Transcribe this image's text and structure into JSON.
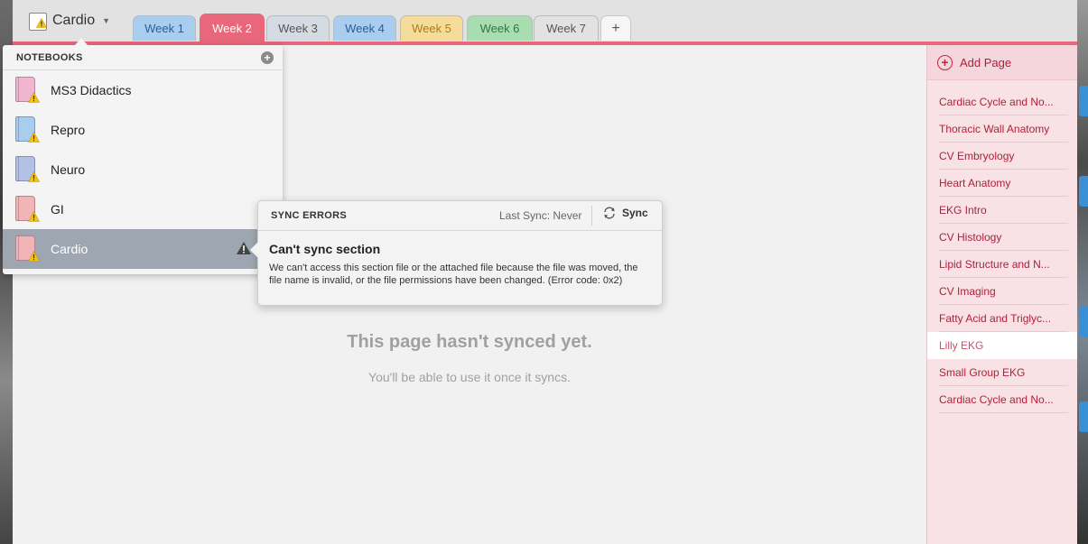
{
  "notebook_switcher": {
    "title": "Cardio"
  },
  "tabs": [
    {
      "label": "Week 1",
      "color": "#a9cdee",
      "text_color": "#2a5f98"
    },
    {
      "label": "Week 2",
      "color": "#e8677a",
      "text_color": "#ffffff"
    },
    {
      "label": "Week 3",
      "color": "#d5dbe2",
      "text_color": "#555555"
    },
    {
      "label": "Week 4",
      "color": "#a9cdee",
      "text_color": "#2a5f98"
    },
    {
      "label": "Week 5",
      "color": "#f6dc9a",
      "text_color": "#b37a12"
    },
    {
      "label": "Week 6",
      "color": "#a9dcb0",
      "text_color": "#2b7a3b"
    },
    {
      "label": "Week 7",
      "color": "#e2e2e2",
      "text_color": "#555555"
    }
  ],
  "add_tab_label": "+",
  "notebooks_panel": {
    "header": "NOTEBOOKS",
    "add_icon": "plus-circle-icon",
    "items": [
      {
        "label": "MS3 Didactics",
        "color": "#f0b6cf",
        "active": false
      },
      {
        "label": "Repro",
        "color": "#a9cdee",
        "active": false
      },
      {
        "label": "Neuro",
        "color": "#b3c1e6",
        "active": false
      },
      {
        "label": "GI",
        "color": "#f3b4b8",
        "active": false
      },
      {
        "label": "Cardio",
        "color": "#f3b4b8",
        "active": true
      }
    ]
  },
  "main": {
    "title": "This page hasn't synced yet.",
    "subtitle": "You'll be able to use it once it syncs."
  },
  "pages": {
    "add_label": "Add Page",
    "items": [
      {
        "label": "Cardiac Cycle and No...",
        "selected": false
      },
      {
        "label": "Thoracic Wall Anatomy",
        "selected": false
      },
      {
        "label": "CV Embryology",
        "selected": false
      },
      {
        "label": "Heart Anatomy",
        "selected": false
      },
      {
        "label": "EKG Intro",
        "selected": false
      },
      {
        "label": "CV Histology",
        "selected": false
      },
      {
        "label": "Lipid Structure and N...",
        "selected": false
      },
      {
        "label": "CV Imaging",
        "selected": false
      },
      {
        "label": "Fatty Acid and Triglyc...",
        "selected": false
      },
      {
        "label": "Lilly EKG",
        "selected": true
      },
      {
        "label": "Small Group EKG",
        "selected": false
      },
      {
        "label": "Cardiac Cycle and No...",
        "selected": false
      }
    ]
  },
  "sync_errors": {
    "title": "SYNC ERRORS",
    "last_sync": "Last Sync: Never",
    "sync_button": "Sync",
    "heading": "Can't sync section",
    "message": "We can't access this section file or the attached file because the file was moved, the file name is invalid, or the file permissions have been changed. (Error code: 0x2)"
  }
}
